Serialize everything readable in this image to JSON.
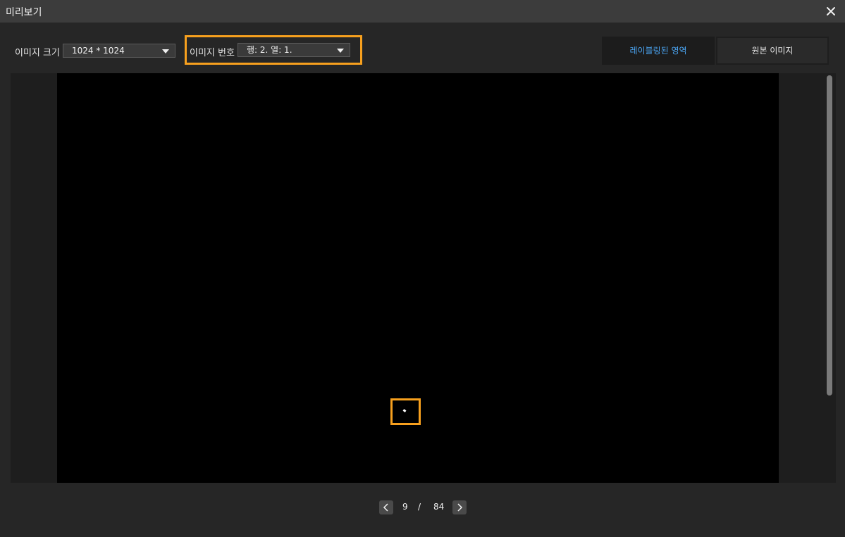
{
  "window": {
    "title": "미리보기",
    "close_icon": "close-icon"
  },
  "toolbar": {
    "image_size_label": "이미지 크기",
    "image_size_value": "1024 * 1024",
    "image_number_label": "이미지 번호",
    "image_number_value": "행: 2. 열: 1.",
    "labeled_region_button": "레이블링된 영역",
    "original_image_button": "원본 이미지"
  },
  "pager": {
    "current": "9",
    "separator": "/",
    "total": "84"
  },
  "colors": {
    "highlight": "#f7a01e",
    "active_tab_text": "#4aa3f0"
  }
}
